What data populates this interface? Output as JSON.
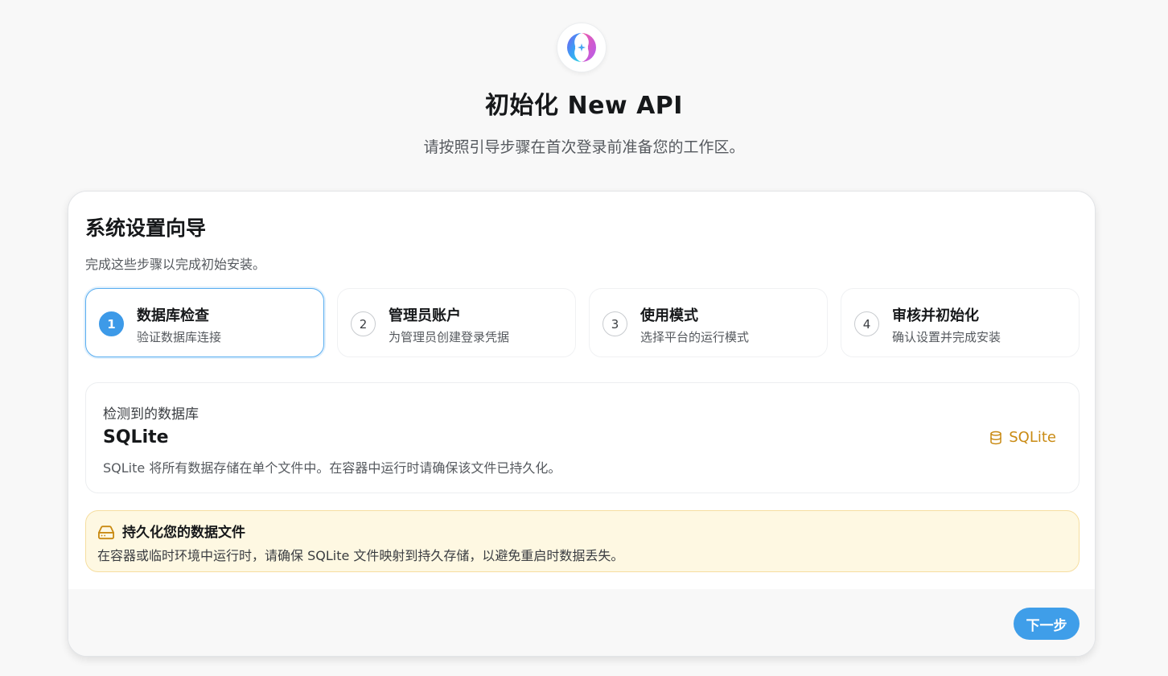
{
  "header": {
    "logo_icon": "new-api-logo-icon",
    "title": "初始化 New API",
    "subtitle": "请按照引导步骤在首次登录前准备您的工作区。"
  },
  "wizard": {
    "title": "系统设置向导",
    "description": "完成这些步骤以完成初始安装。",
    "active_step": 1,
    "steps": [
      {
        "number": "1",
        "title": "数据库检查",
        "subtitle": "验证数据库连接"
      },
      {
        "number": "2",
        "title": "管理员账户",
        "subtitle": "为管理员创建登录凭据"
      },
      {
        "number": "3",
        "title": "使用模式",
        "subtitle": "选择平台的运行模式"
      },
      {
        "number": "4",
        "title": "审核并初始化",
        "subtitle": "确认设置并完成安装"
      }
    ]
  },
  "database": {
    "label": "检测到的数据库",
    "name": "SQLite",
    "description": "SQLite 将所有数据存储在单个文件中。在容器中运行时请确保该文件已持久化。",
    "badge_label": "SQLite",
    "badge_icon": "database-icon"
  },
  "notice": {
    "icon": "hard-drive-icon",
    "title": "持久化您的数据文件",
    "text": "在容器或临时环境中运行时，请确保 SQLite 文件映射到持久存储，以避免重启时数据丢失。"
  },
  "footer": {
    "next_label": "下一步"
  },
  "colors": {
    "accent": "#3f9ee9",
    "warning": "#c98a12",
    "warning_bg": "#fef8e2"
  }
}
